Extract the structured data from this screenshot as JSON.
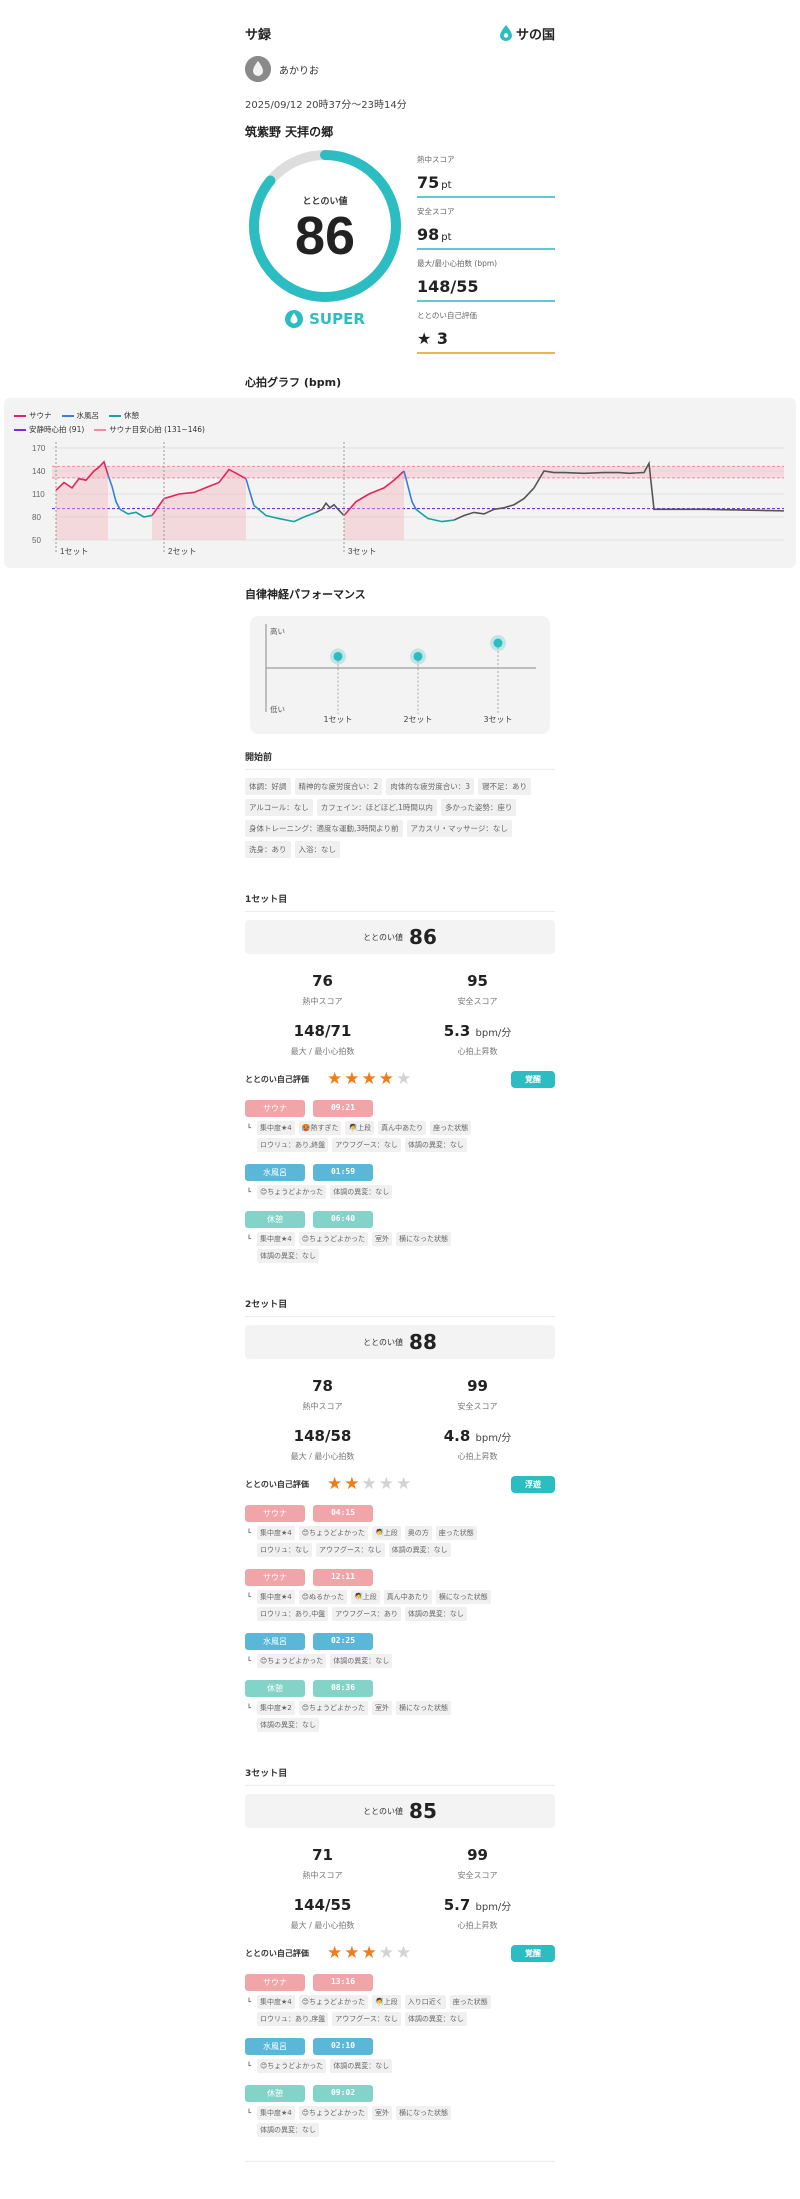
{
  "header": {
    "app_title": "サ録",
    "logo_text": "サの国"
  },
  "user": {
    "name": "あかりお"
  },
  "session": {
    "date": "2025/09/12 20時37分〜23時14分",
    "facility": "筑紫野 天拝の郷",
    "totonoi_label": "ととのい値",
    "totonoi_value": "86",
    "totonoi_progress": 0.86,
    "rank": "SUPER"
  },
  "metrics": [
    {
      "label": "熱中スコア",
      "value": "75",
      "unit": "pt"
    },
    {
      "label": "安全スコア",
      "value": "98",
      "unit": "pt"
    },
    {
      "label": "最大/最小心拍数 (bpm)",
      "value": "148/55",
      "unit": ""
    },
    {
      "label": "ととのい自己評価",
      "value": "★ 3",
      "unit": ""
    }
  ],
  "heart_graph": {
    "title": "心拍グラフ (bpm)",
    "legend": {
      "sauna": "サウナ",
      "water": "水風呂",
      "rest": "休憩",
      "resting": "安静時心拍 (91)",
      "target": "サウナ目安心拍 (131~146)"
    },
    "y_ticks": [
      "170",
      "140",
      "110",
      "80",
      "50"
    ],
    "set_labels": [
      "1セット",
      "2セット",
      "3セット"
    ]
  },
  "chart_data": [
    {
      "type": "line",
      "title": "心拍グラフ (bpm)",
      "ylim": [
        50,
        170
      ],
      "resting_hr": 91,
      "target_range": [
        131,
        146
      ],
      "series": [
        {
          "name": "サウナ",
          "color": "#e0245e"
        },
        {
          "name": "水風呂",
          "color": "#3b7fd4"
        },
        {
          "name": "休憩",
          "color": "#1aa19c"
        }
      ]
    },
    {
      "type": "scatter",
      "title": "自律神経パフォーマンス",
      "categories": [
        "1セット",
        "2セット",
        "3セット"
      ],
      "values": [
        0.62,
        0.62,
        0.76
      ],
      "ylabel_high": "高い",
      "ylabel_low": "低い"
    }
  ],
  "autonomic": {
    "title": "自律神経パフォーマンス",
    "high": "高い",
    "low": "低い",
    "labels": [
      "1セット",
      "2セット",
      "3セット"
    ]
  },
  "pre": {
    "title": "開始前",
    "chips": [
      "体調：好調",
      "精神的な疲労度合い：2",
      "肉体的な疲労度合い：3",
      "寝不足：あり",
      "アルコール：なし",
      "カフェイン：ほどほど,1時間以内",
      "多かった姿勢：座り",
      "身体トレーニング：適度な運動,3時間より前",
      "アカスリ・マッサージ：なし",
      "洗身：あり",
      "入浴：なし"
    ]
  },
  "sets": [
    {
      "title": "1セット目",
      "totonoi_label": "ととのい値",
      "totonoi": "86",
      "stats": [
        {
          "v": "76",
          "u": "",
          "l": "熱中スコア"
        },
        {
          "v": "95",
          "u": "",
          "l": "安全スコア"
        },
        {
          "v": "148/71",
          "u": "",
          "l": "最大 / 最小心拍数"
        },
        {
          "v": "5.3",
          "u": "bpm/分",
          "l": "心拍上昇数"
        }
      ],
      "eval_label": "ととのい自己評価",
      "stars": 4,
      "badge": "覚醒",
      "phases": [
        {
          "type": "サウナ",
          "kind": "sauna",
          "time": "09:21",
          "rows": [
            [
              "集中度★4",
              "🥵熱すぎた",
              "🧖上段",
              "真ん中あたり",
              "座った状態"
            ],
            [
              "ロウリュ：あり,終盤",
              "アウフグース：なし",
              "体調の異変：なし"
            ]
          ]
        },
        {
          "type": "水風呂",
          "kind": "water",
          "time": "01:59",
          "rows": [
            [
              "😊ちょうどよかった",
              "体調の異変：なし"
            ]
          ]
        },
        {
          "type": "休憩",
          "kind": "rest",
          "time": "06:40",
          "rows": [
            [
              "集中度★4",
              "😊ちょうどよかった",
              "室外",
              "横になった状態"
            ],
            [
              "体調の異変：なし"
            ]
          ]
        }
      ]
    },
    {
      "title": "2セット目",
      "totonoi_label": "ととのい値",
      "totonoi": "88",
      "stats": [
        {
          "v": "78",
          "u": "",
          "l": "熱中スコア"
        },
        {
          "v": "99",
          "u": "",
          "l": "安全スコア"
        },
        {
          "v": "148/58",
          "u": "",
          "l": "最大 / 最小心拍数"
        },
        {
          "v": "4.8",
          "u": "bpm/分",
          "l": "心拍上昇数"
        }
      ],
      "eval_label": "ととのい自己評価",
      "stars": 2,
      "badge": "浮遊",
      "phases": [
        {
          "type": "サウナ",
          "kind": "sauna",
          "time": "04:15",
          "rows": [
            [
              "集中度★4",
              "😊ちょうどよかった",
              "🧖上段",
              "奥の方",
              "座った状態"
            ],
            [
              "ロウリュ：なし",
              "アウフグース：なし",
              "体調の異変：なし"
            ]
          ]
        },
        {
          "type": "サウナ",
          "kind": "sauna",
          "time": "12:11",
          "rows": [
            [
              "集中度★4",
              "😊ぬるかった",
              "🧖上段",
              "真ん中あたり",
              "横になった状態"
            ],
            [
              "ロウリュ：あり,中盤",
              "アウフグース：あり",
              "体調の異変：なし"
            ]
          ]
        },
        {
          "type": "水風呂",
          "kind": "water",
          "time": "02:25",
          "rows": [
            [
              "😊ちょうどよかった",
              "体調の異変：なし"
            ]
          ]
        },
        {
          "type": "休憩",
          "kind": "rest",
          "time": "08:36",
          "rows": [
            [
              "集中度★2",
              "😊ちょうどよかった",
              "室外",
              "横になった状態"
            ],
            [
              "体調の異変：なし"
            ]
          ]
        }
      ]
    },
    {
      "title": "3セット目",
      "totonoi_label": "ととのい値",
      "totonoi": "85",
      "stats": [
        {
          "v": "71",
          "u": "",
          "l": "熱中スコア"
        },
        {
          "v": "99",
          "u": "",
          "l": "安全スコア"
        },
        {
          "v": "144/55",
          "u": "",
          "l": "最大 / 最小心拍数"
        },
        {
          "v": "5.7",
          "u": "bpm/分",
          "l": "心拍上昇数"
        }
      ],
      "eval_label": "ととのい自己評価",
      "stars": 3,
      "badge": "覚醒",
      "phases": [
        {
          "type": "サウナ",
          "kind": "sauna",
          "time": "13:16",
          "rows": [
            [
              "集中度★4",
              "😊ちょうどよかった",
              "🧖上段",
              "入り口近く",
              "座った状態"
            ],
            [
              "ロウリュ：あり,序盤",
              "アウフグース：なし",
              "体調の異変：なし"
            ]
          ]
        },
        {
          "type": "水風呂",
          "kind": "water",
          "time": "02:10",
          "rows": [
            [
              "😊ちょうどよかった",
              "体調の異変：なし"
            ]
          ]
        },
        {
          "type": "休憩",
          "kind": "rest",
          "time": "09:02",
          "rows": [
            [
              "集中度★4",
              "😊ちょうどよかった",
              "室外",
              "横になった状態"
            ],
            [
              "体調の異変：なし"
            ]
          ]
        }
      ]
    }
  ],
  "colors": {
    "accent": "#2bbdc2",
    "sauna": "#e0245e",
    "water": "#3b7fd4",
    "rest": "#1aa19c",
    "star": "#ef7d1a"
  }
}
